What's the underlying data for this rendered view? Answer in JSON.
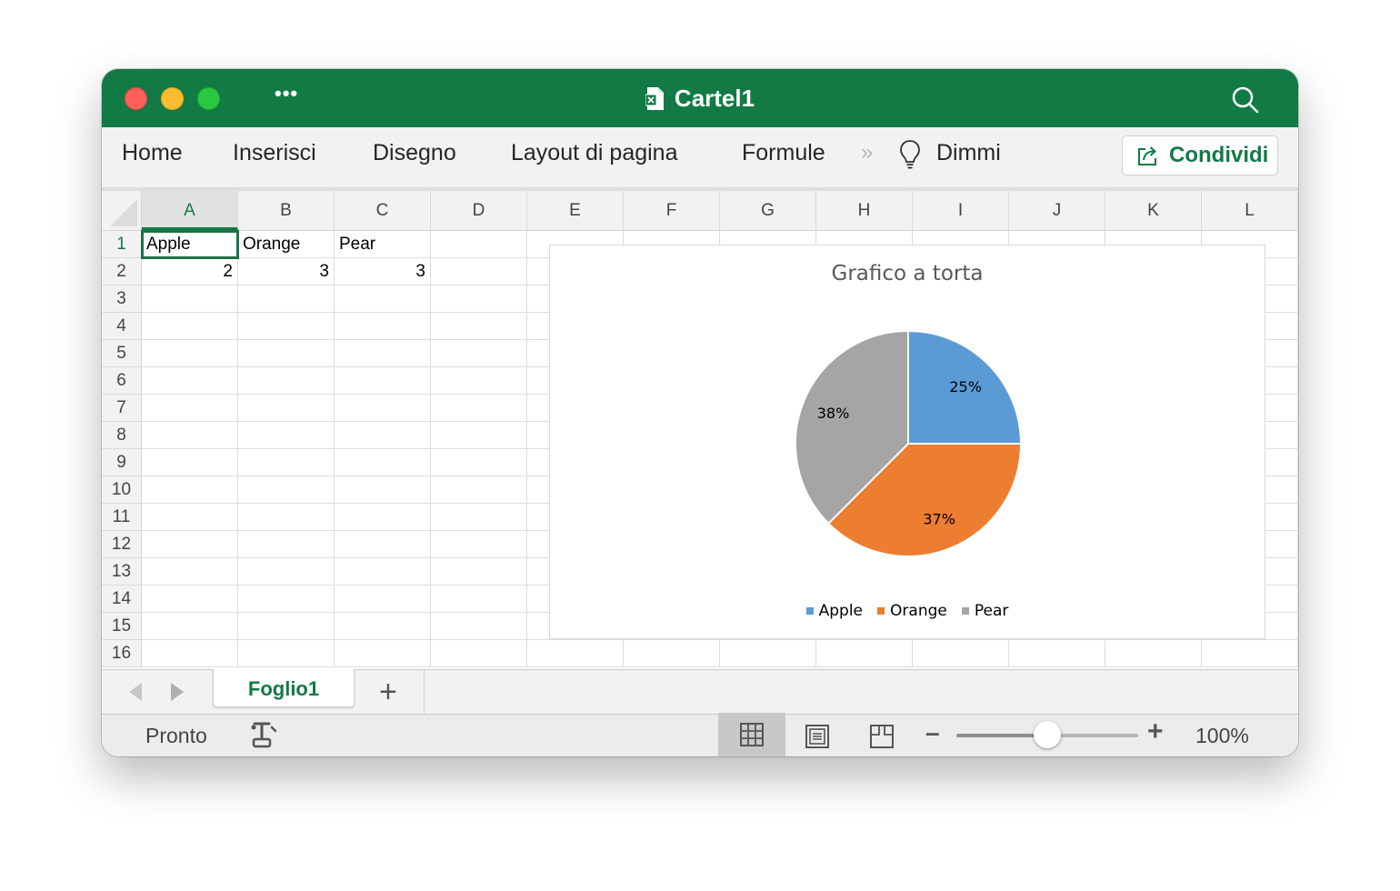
{
  "window": {
    "title": "Cartel1",
    "more_label": "•••"
  },
  "ribbon": {
    "tabs": [
      "Home",
      "Inserisci",
      "Disegno",
      "Layout di pagina",
      "Formule",
      "Dimmi"
    ],
    "overflow": "»",
    "share_label": "Condividi"
  },
  "sheet": {
    "columns": [
      "A",
      "B",
      "C",
      "D",
      "E",
      "F",
      "G",
      "H",
      "I",
      "J",
      "K",
      "L"
    ],
    "rows": [
      "1",
      "2",
      "3",
      "4",
      "5",
      "6",
      "7",
      "8",
      "9",
      "10",
      "11",
      "12",
      "13",
      "14",
      "15",
      "16"
    ],
    "selected_cell": "A1",
    "cells": {
      "A1": "Apple",
      "B1": "Orange",
      "C1": "Pear",
      "A2": "2",
      "B2": "3",
      "C2": "3"
    }
  },
  "chart_data": {
    "type": "pie",
    "title": "Grafico a torta",
    "categories": [
      "Apple",
      "Orange",
      "Pear"
    ],
    "values": [
      2,
      3,
      3
    ],
    "labels": [
      "25%",
      "37%",
      "38%"
    ],
    "colors": [
      "#5b9bd5",
      "#ed7d31",
      "#a5a5a5"
    ],
    "legend": "bottom"
  },
  "sheet_tabs": {
    "active": "Foglio1",
    "add_label": "+"
  },
  "status": {
    "text": "Pronto",
    "zoom_minus": "–",
    "zoom_plus": "+",
    "zoom": "100%",
    "zoom_level": 0.5
  },
  "colors": {
    "brand": "#117a45"
  }
}
